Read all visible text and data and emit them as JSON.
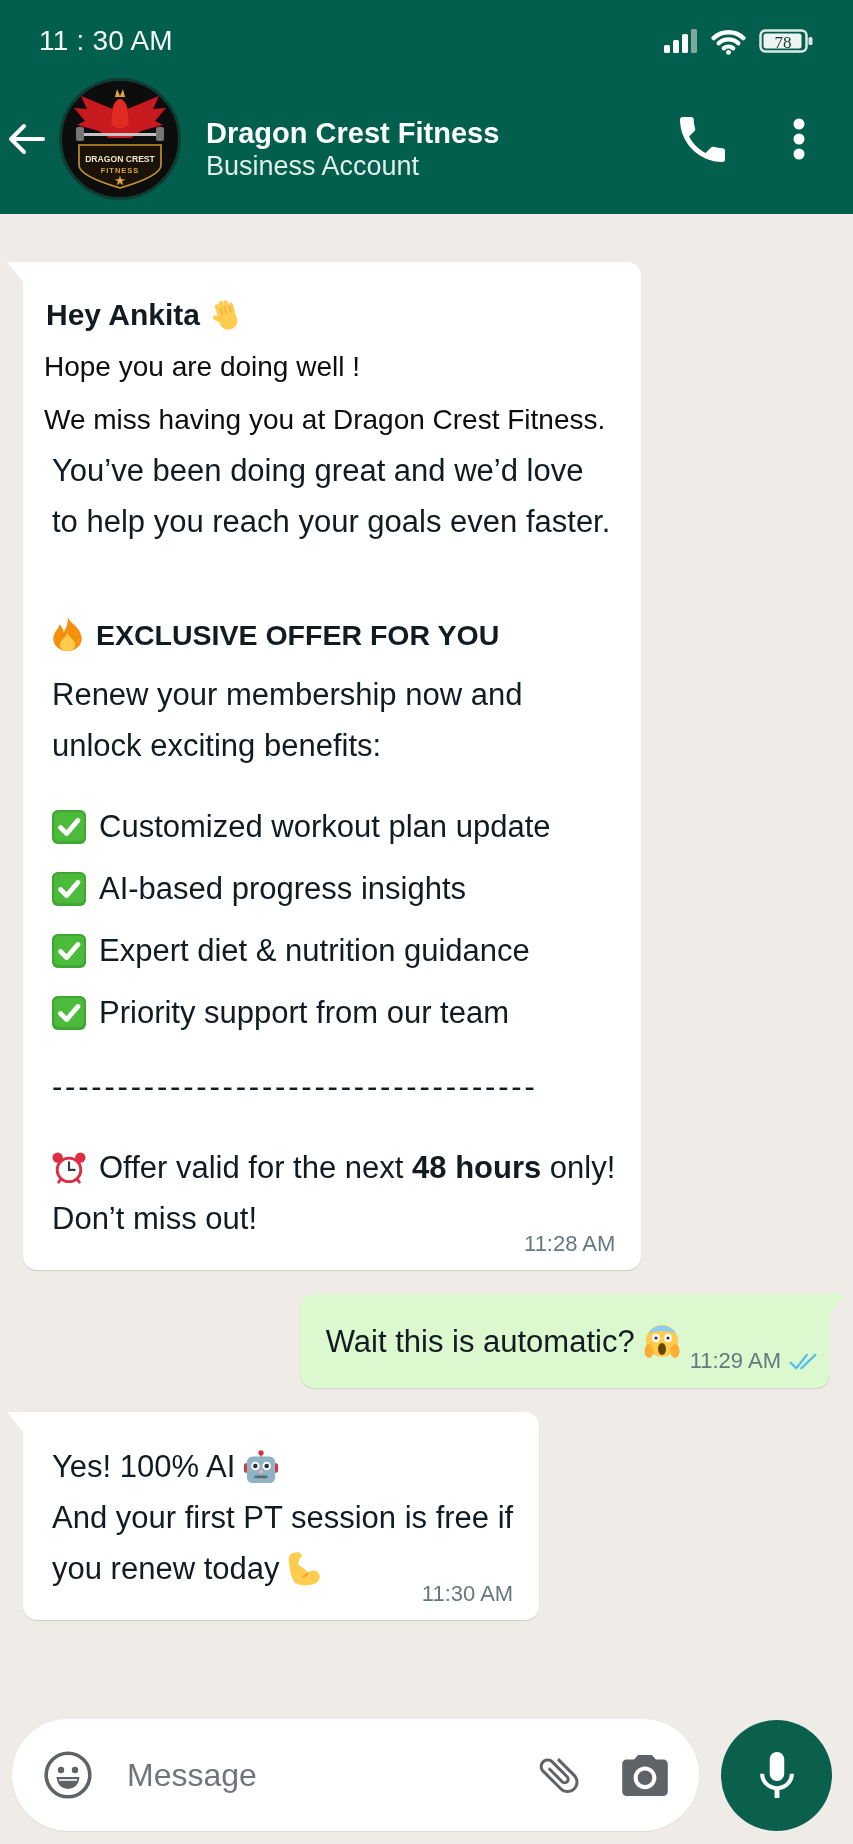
{
  "status_bar": {
    "time": "11 : 30 AM",
    "battery_text": "78"
  },
  "header": {
    "avatar": {
      "logo_title": "DRAGON CREST",
      "logo_subtitle": "FITNESS"
    },
    "title": "Dragon Crest Fitness",
    "subtitle": "Business Account"
  },
  "messages": [
    {
      "kind": "incoming",
      "lines": [
        {
          "kind": "greeting",
          "text": "Hey Ankita",
          "trail": {
            "kind": "waving_hand"
          }
        },
        {
          "kind": "intro",
          "text": "Hope you are doing well !"
        },
        {
          "kind": "intro",
          "text": "We miss having you at Dragon Crest Fitness."
        },
        {
          "kind": "body",
          "text": "You’ve been doing great and we’d love\nto help you reach your goals even faster."
        },
        {
          "kind": "heading",
          "text": "EXCLUSIVE OFFER FOR YOU",
          "lead": {
            "kind": "fire"
          }
        },
        {
          "kind": "body",
          "text": "Renew your membership now and\nunlock exciting benefits:"
        },
        {
          "kind": "check_item",
          "text": "Customized workout plan update",
          "lead": {
            "kind": "check_mark_button"
          }
        },
        {
          "kind": "check_item",
          "text": "AI-based progress insights",
          "lead": {
            "kind": "check_mark_button"
          }
        },
        {
          "kind": "check_item",
          "text": "Expert diet & nutrition guidance",
          "lead": {
            "kind": "check_mark_button"
          }
        },
        {
          "kind": "check_item",
          "text": "Priority support from our team",
          "lead": {
            "kind": "check_mark_button"
          }
        },
        {
          "kind": "dashes",
          "text": "-------------------------------------"
        },
        {
          "kind": "body",
          "text": "Offer valid for the next **48 hours** only!",
          "lead": {
            "kind": "alarm_clock"
          }
        },
        {
          "kind": "body",
          "text": "Don’t miss out!"
        }
      ],
      "time": "11:28 AM"
    },
    {
      "kind": "outgoing",
      "lines": [
        {
          "kind": "body",
          "text": "Wait this is automatic?",
          "trail": {
            "kind": "screaming_face"
          }
        }
      ],
      "time": "11:29 AM",
      "read": true
    },
    {
      "kind": "incoming",
      "lines": [
        {
          "kind": "body",
          "text": "Yes! 100% AI",
          "trail": {
            "kind": "robot"
          }
        },
        {
          "kind": "body",
          "text": "And your first PT session is free if"
        },
        {
          "kind": "body",
          "text": "you renew today",
          "trail": {
            "kind": "flexed_biceps"
          }
        }
      ],
      "time": "11:30 AM"
    }
  ],
  "composer": {
    "placeholder": "Message"
  }
}
